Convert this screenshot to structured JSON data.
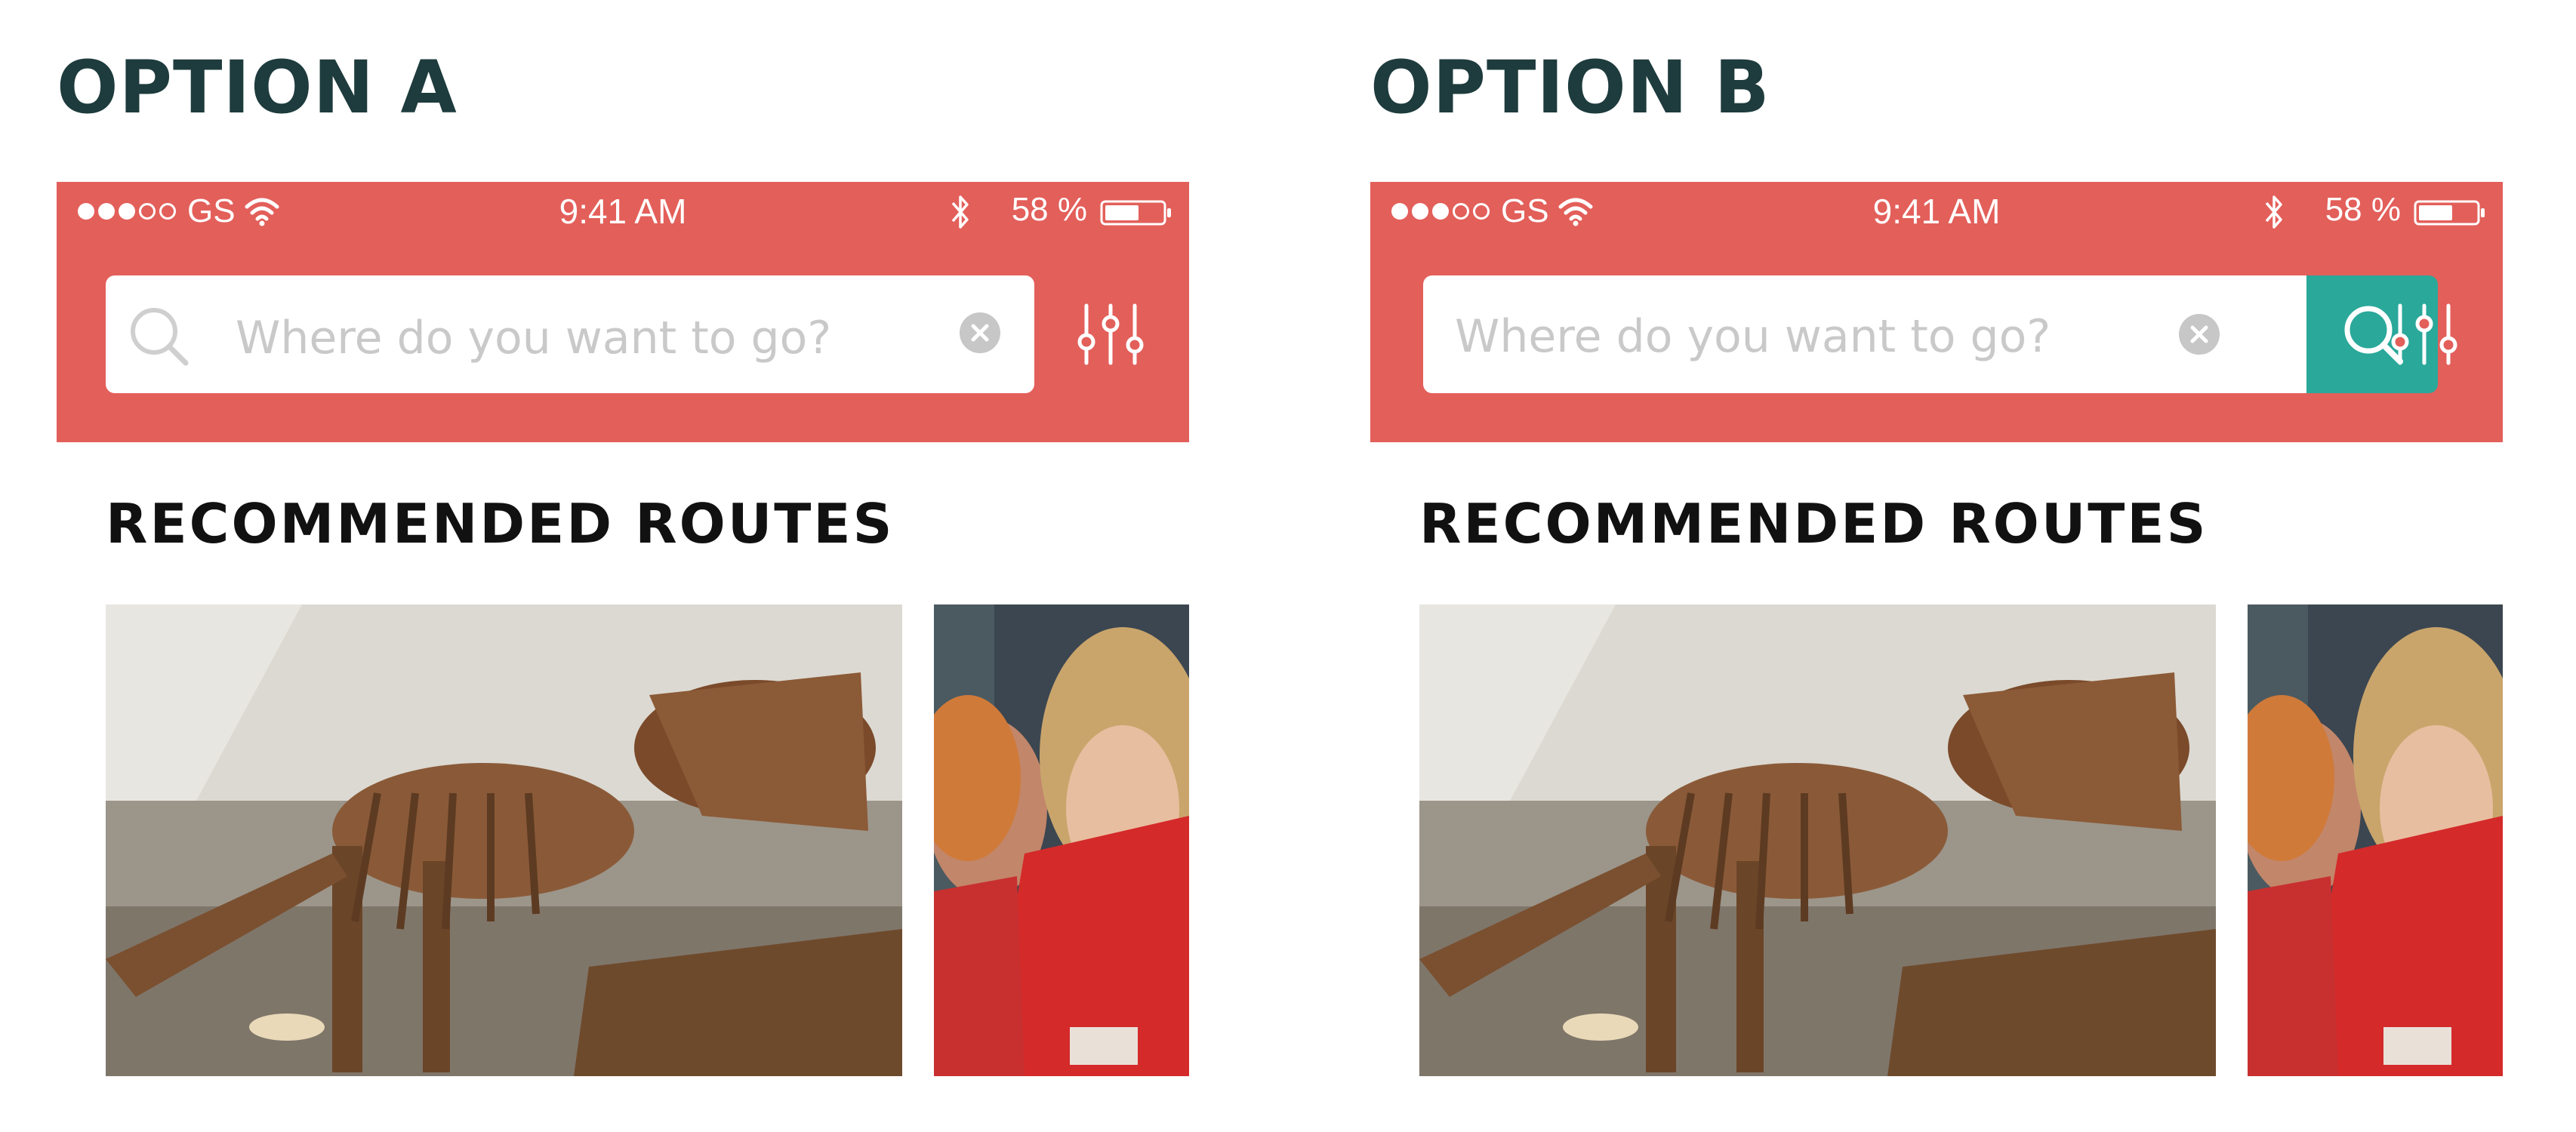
{
  "options": [
    {
      "title": "OPTION A",
      "status_bar": {
        "carrier": "GS",
        "time": "9:41 AM",
        "battery": "58 %"
      },
      "search": {
        "placeholder": "Where do you want to go?"
      },
      "section_title": "RECOMMENDED ROUTES"
    },
    {
      "title": "OPTION B",
      "status_bar": {
        "carrier": "GS",
        "time": "9:41 AM",
        "battery": "58 %"
      },
      "search": {
        "placeholder": "Where do you want to go?"
      },
      "section_title": "RECOMMENDED ROUTES"
    }
  ],
  "colors": {
    "app_bar": "#e35f5a",
    "search_button": "#2aa89a",
    "heading": "#1e3b3d"
  }
}
